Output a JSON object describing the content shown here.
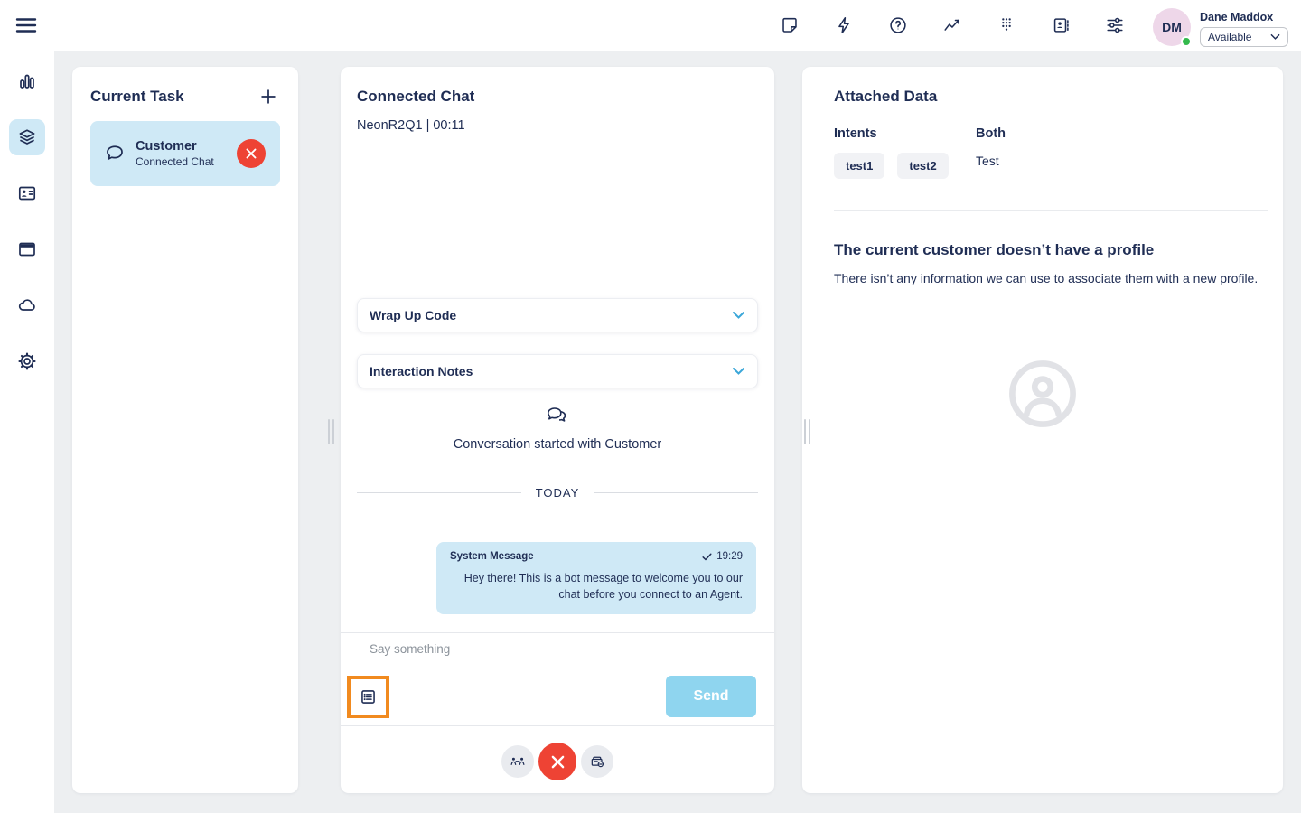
{
  "colors": {
    "navy": "#1f2d54",
    "background": "#edeff1",
    "light_blue": "#cfe9f6",
    "red": "#ee4334",
    "send_blue": "#8fd5ef",
    "orange": "#f18a1f",
    "chevron_blue": "#3ba7d9",
    "avatar_pink": "#eed7e9",
    "status_green": "#33b94c"
  },
  "topbar": {
    "icons": [
      "note-icon",
      "lightning-icon",
      "help-icon",
      "analytics-icon",
      "dialpad-icon",
      "contacts-icon",
      "preferences-icon"
    ],
    "user": {
      "initials": "DM",
      "name": "Dane Maddox",
      "status": "Available"
    }
  },
  "sidebar": {
    "items": [
      "performance",
      "interactions",
      "directory",
      "apps",
      "cloud",
      "settings"
    ],
    "active": "interactions"
  },
  "task_panel": {
    "title": "Current Task",
    "card": {
      "title": "Customer",
      "subtitle": "Connected Chat"
    }
  },
  "chat_panel": {
    "title": "Connected Chat",
    "session": "NeonR2Q1 | 00:11",
    "wrap_up_label": "Wrap Up Code",
    "notes_label": "Interaction Notes",
    "started_text": "Conversation started with Customer",
    "day_divider": "TODAY",
    "message": {
      "sender": "System Message",
      "time": "19:29",
      "text": "Hey there! This is a bot message to welcome you to our chat before you connect to an Agent."
    },
    "input_placeholder": "Say something",
    "send_label": "Send"
  },
  "data_panel": {
    "title": "Attached Data",
    "intents_label": "Intents",
    "intents": [
      "test1",
      "test2"
    ],
    "both_label": "Both",
    "both_value": "Test",
    "no_profile_title": "The current customer doesn’t have a profile",
    "no_profile_text": "There isn’t any information we can use to associate them with a new profile."
  }
}
